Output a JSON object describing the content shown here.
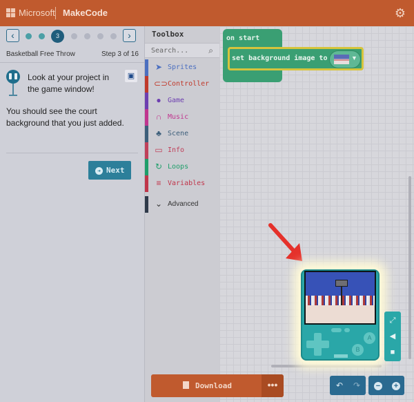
{
  "header": {
    "brand": "Microsoft",
    "product": "MakeCode",
    "settings_icon": "gear-icon"
  },
  "tutorial": {
    "current_step_label": "3",
    "step_dots": [
      "done",
      "done",
      "current",
      "todo",
      "todo",
      "todo",
      "todo"
    ],
    "title": "Basketball Free Throw",
    "step_counter": "Step 3 of 16",
    "instruction_1": "Look at your project in the game window!",
    "instruction_2": "You should see the court background that you just added.",
    "next_label": "Next"
  },
  "toolbox": {
    "title": "Toolbox",
    "search_placeholder": "Search...",
    "categories": [
      {
        "label": "Sprites",
        "color": "#4b6fc0",
        "icon": "paper-plane-icon"
      },
      {
        "label": "Controller",
        "color": "#c0392b",
        "icon": "gamepad-icon"
      },
      {
        "label": "Game",
        "color": "#6d3fb0",
        "icon": "circle-icon"
      },
      {
        "label": "Music",
        "color": "#c0368f",
        "icon": "headphones-icon"
      },
      {
        "label": "Scene",
        "color": "#3c5e7a",
        "icon": "tree-icon"
      },
      {
        "label": "Info",
        "color": "#c0405a",
        "icon": "id-card-icon"
      },
      {
        "label": "Loops",
        "color": "#1e9e6a",
        "icon": "refresh-icon"
      },
      {
        "label": "Variables",
        "color": "#c0354a",
        "icon": "list-icon"
      }
    ],
    "advanced_label": "Advanced"
  },
  "workspace": {
    "on_start_label": "on start",
    "set_background_label": "set background image to"
  },
  "simulator": {
    "button_a": "A",
    "button_b": "B"
  },
  "bottom": {
    "download_label": "Download",
    "more_label": "•••"
  }
}
